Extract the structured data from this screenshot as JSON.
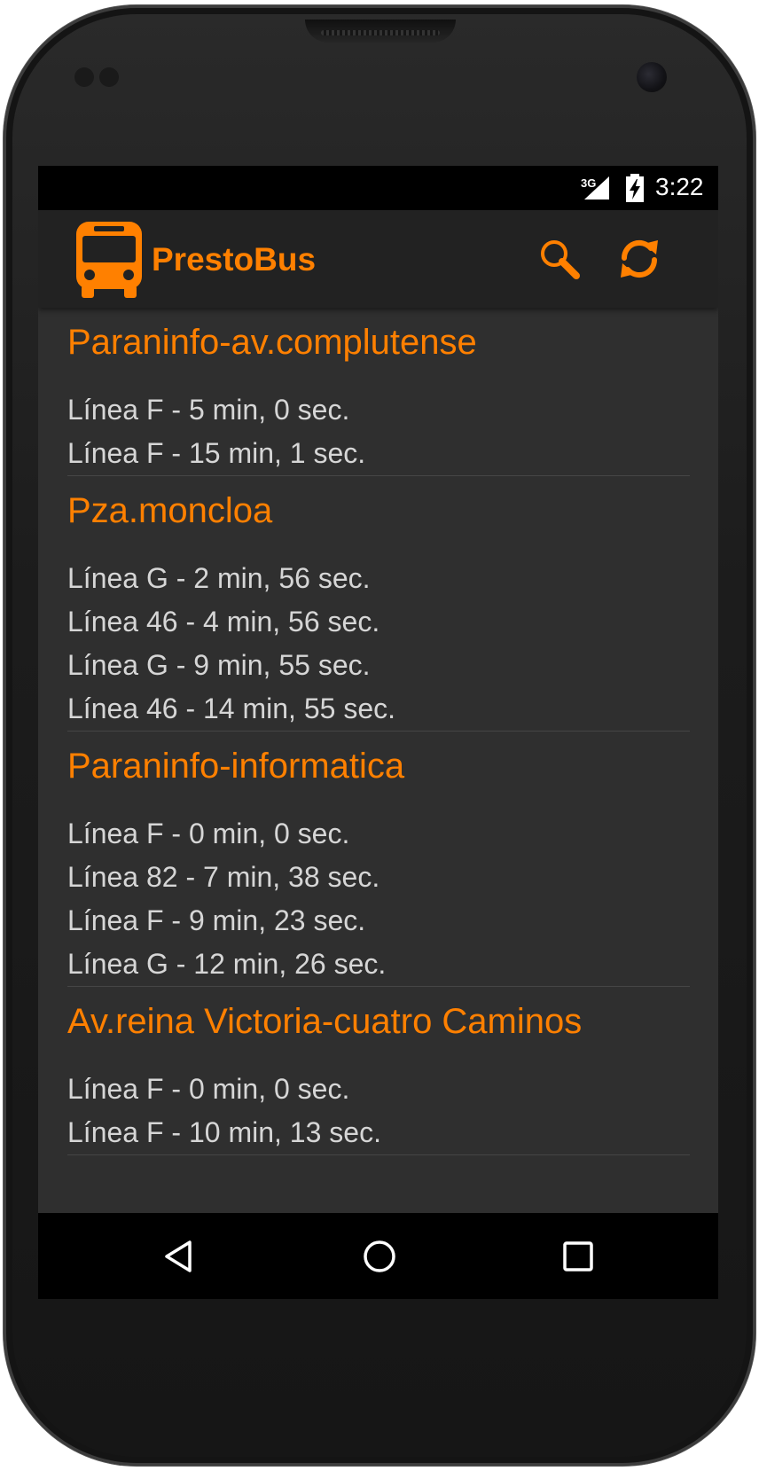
{
  "status_bar": {
    "network": "3G",
    "time": "3:22"
  },
  "action_bar": {
    "title": "PrestoBus",
    "accent_color": "#ff8000",
    "actions": [
      {
        "icon": "search-icon"
      },
      {
        "icon": "refresh-icon"
      }
    ]
  },
  "stops": [
    {
      "name": "Paraninfo-av.complutense",
      "arrivals": [
        "Línea F - 5 min, 0 sec.",
        "Línea F - 15 min, 1 sec."
      ]
    },
    {
      "name": "Pza.moncloa",
      "arrivals": [
        "Línea G - 2 min, 56 sec.",
        "Línea 46 - 4 min, 56 sec.",
        "Línea G - 9 min, 55 sec.",
        "Línea 46 - 14 min, 55 sec."
      ]
    },
    {
      "name": "Paraninfo-informatica",
      "arrivals": [
        "Línea F - 0 min, 0 sec.",
        "Línea 82 - 7 min, 38 sec.",
        "Línea F - 9 min, 23 sec.",
        "Línea G - 12 min, 26 sec."
      ]
    },
    {
      "name": "Av.reina Victoria-cuatro Caminos",
      "arrivals": [
        "Línea F - 0 min, 0 sec.",
        "Línea F - 10 min, 13 sec."
      ]
    }
  ],
  "nav_bar": {
    "buttons": [
      {
        "icon": "back-icon"
      },
      {
        "icon": "home-icon"
      },
      {
        "icon": "recents-icon"
      }
    ]
  }
}
